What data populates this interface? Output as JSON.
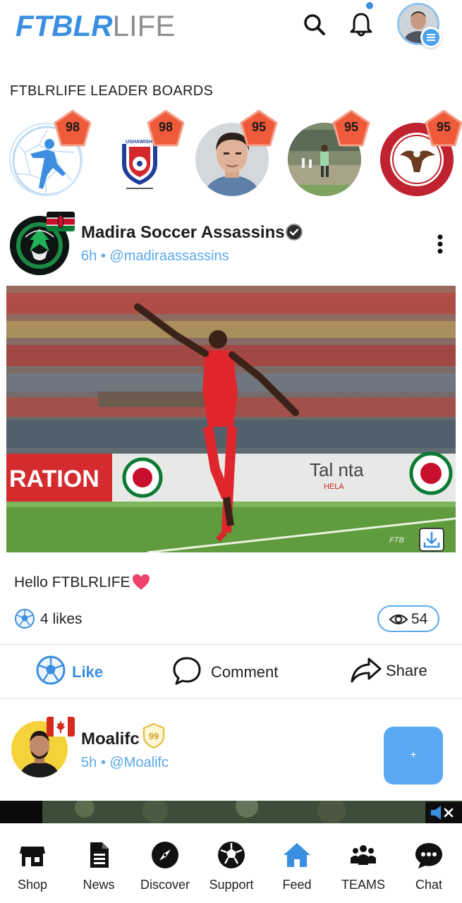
{
  "header": {
    "logo_bold": "FTBLR",
    "logo_light": "LIFE",
    "accent_color": "#3a8fe0"
  },
  "leaderboards": {
    "title": "FTBLRLIFE LEADER BOARDS",
    "items": [
      {
        "score": "98",
        "icon": "soccer-player-ball-logo"
      },
      {
        "score": "98",
        "icon": "ushawishi-academy-crest"
      },
      {
        "score": "95",
        "icon": "man-portrait"
      },
      {
        "score": "95",
        "icon": "player-on-pitch-photo"
      },
      {
        "score": "95",
        "icon": "mighty-soccer-academy-crest"
      }
    ],
    "badge_color": "#f0573a"
  },
  "post1": {
    "author": "Madira Soccer Assassins",
    "time": "6h",
    "separator": "•",
    "handle": "@madiraassassins",
    "caption": "Hello FTBLRLIFE",
    "likes": "4 likes",
    "views": "54",
    "image_banner_left": "RATION",
    "image_banner_mid": "Tal nta",
    "image_banner_sub": "HELA",
    "watermark": "FTB"
  },
  "actions": {
    "like": "Like",
    "comment": "Comment",
    "share": "Share"
  },
  "post2": {
    "author": "Moalifc",
    "rank": "99",
    "time": "5h",
    "separator": "•",
    "handle": "@Moalifc",
    "fab_label": "+"
  },
  "nav": {
    "items": [
      {
        "label": "Shop",
        "icon": "shop-icon"
      },
      {
        "label": "News",
        "icon": "news-icon"
      },
      {
        "label": "Discover",
        "icon": "compass-icon"
      },
      {
        "label": "Support",
        "icon": "soccer-ball-icon"
      },
      {
        "label": "Feed",
        "icon": "home-icon",
        "active": true
      },
      {
        "label": "TEAMS",
        "icon": "team-icon"
      },
      {
        "label": "Chat",
        "icon": "chat-icon"
      }
    ],
    "active_color": "#3a8fe0"
  }
}
